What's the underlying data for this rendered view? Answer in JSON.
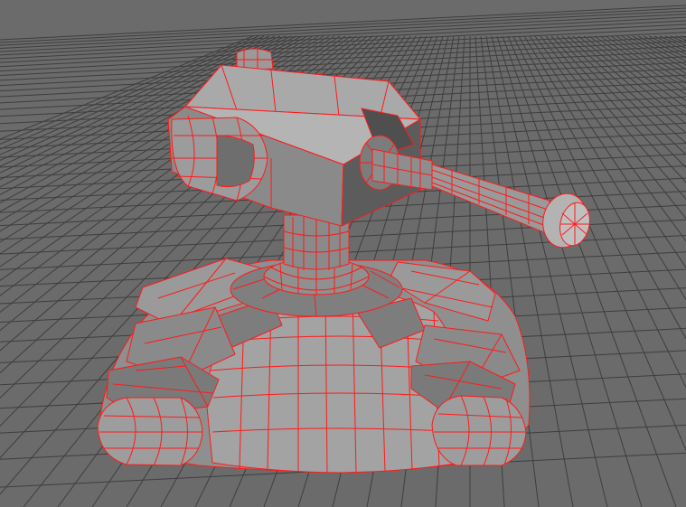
{
  "viewport": {
    "background_color": "#6b6b6b",
    "grid_color": "#3e3e3e",
    "grid_major_color": "#2e2e2e",
    "wireframe_color": "#ff1a1a",
    "mesh_light_color": "#a7a7a7",
    "mesh_mid_color": "#8f8f8f",
    "mesh_dark_color": "#6e6e6e",
    "mesh_shadow_color": "#4b4b4b"
  },
  "model": {
    "icon": "turret-model-icon"
  }
}
